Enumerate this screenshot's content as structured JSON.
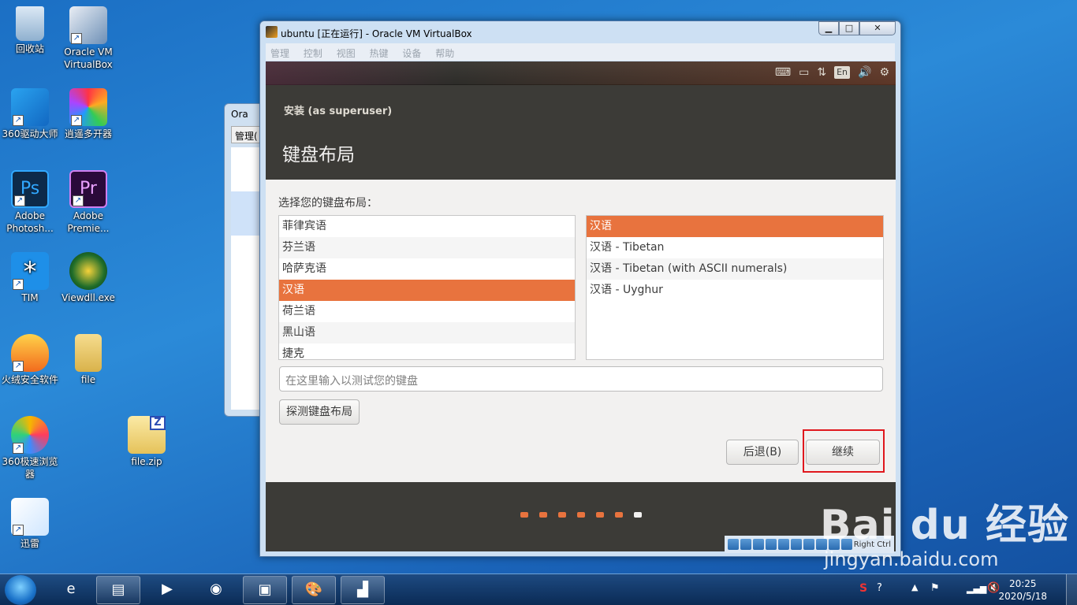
{
  "desktop": {
    "icons": [
      {
        "label": "回收站",
        "icon": "recycle-bin-icon"
      },
      {
        "label": "Oracle VM VirtualBox",
        "icon": "virtualbox-icon"
      },
      {
        "label": "360驱动大师",
        "icon": "driver-master-icon"
      },
      {
        "label": "逍遥多开器",
        "icon": "multi-opener-icon"
      },
      {
        "label": "Adobe Photosh...",
        "icon": "photoshop-icon"
      },
      {
        "label": "Adobe Premie...",
        "icon": "premiere-icon"
      },
      {
        "label": "TIM",
        "icon": "tim-icon"
      },
      {
        "label": "Viewdll.exe",
        "icon": "viewdll-icon"
      },
      {
        "label": "火绒安全软件",
        "icon": "huorong-icon"
      },
      {
        "label": "file",
        "icon": "folder-icon"
      },
      {
        "label": "360极速浏览器",
        "icon": "browser-icon"
      },
      {
        "label": "file.zip",
        "icon": "zip-icon"
      },
      {
        "label": "迅雷",
        "icon": "thunder-icon"
      }
    ]
  },
  "bg_window": {
    "title": "Ora",
    "menu": "管理("
  },
  "vm_window": {
    "title": "ubuntu [正在运行] - Oracle VM VirtualBox",
    "menu": [
      "管理",
      "控制",
      "视图",
      "热键",
      "设备",
      "帮助"
    ],
    "guest_indicator": "En",
    "host_key": "Right Ctrl"
  },
  "installer": {
    "subtitle": "安装 (as superuser)",
    "title": "键盘布局",
    "prompt": "选择您的键盘布局：",
    "layouts": [
      "菲律宾语",
      "芬兰语",
      "哈萨克语",
      "汉语",
      "荷兰语",
      "黑山语",
      "捷克"
    ],
    "selected_layout_index": 3,
    "variants": [
      "汉语",
      "汉语 - Tibetan",
      "汉语 - Tibetan (with ASCII numerals)",
      "汉语 - Uyghur"
    ],
    "selected_variant_index": 0,
    "test_placeholder": "在这里输入以测试您的键盘",
    "detect_button": "探测键盘布局",
    "back_button": "后退(B)",
    "continue_button": "继续",
    "progress_total": 7,
    "progress_current": 7
  },
  "taskbar": {
    "time": "20:25",
    "date": "2020/5/18"
  },
  "watermark": {
    "brand": "Bai du 经验",
    "url": "jingyan.baidu.com"
  },
  "colors": {
    "ubuntu_orange": "#e8733e",
    "ubuntu_dark": "#3c3b37",
    "highlight": "#e0181e"
  }
}
